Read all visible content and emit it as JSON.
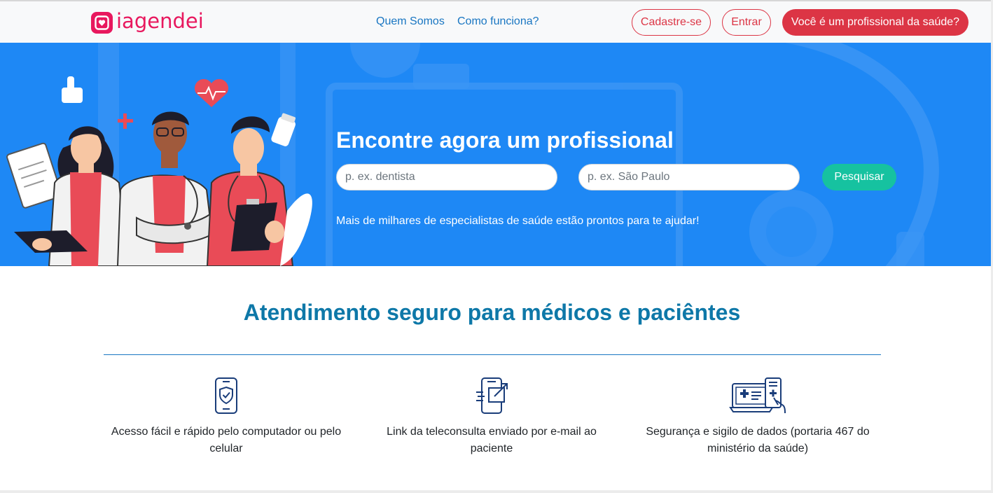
{
  "header": {
    "logo_text": "iagendei",
    "nav": [
      {
        "label": "Quem Somos"
      },
      {
        "label": "Como funciona?"
      }
    ],
    "signup_label": "Cadastre-se",
    "login_label": "Entrar",
    "pro_label": "Você é um profissional da saúde?"
  },
  "hero": {
    "title": "Encontre agora um profissional",
    "specialty_placeholder": "p. ex. dentista",
    "location_placeholder": "p. ex. São Paulo",
    "search_label": "Pesquisar",
    "subtitle": "Mais de milhares de especialistas de saúde estão prontos para te ajudar!"
  },
  "features": {
    "title": "Atendimento seguro para médicos e paciêntes",
    "items": [
      {
        "icon": "shield-phone-icon",
        "text": "Acesso fácil e rápido pelo computador ou pelo celular"
      },
      {
        "icon": "phone-link-icon",
        "text": "Link da teleconsulta enviado por e-mail ao paciente"
      },
      {
        "icon": "medical-devices-icon",
        "text": "Segurança e sigilo de dados (portaria 467 do ministério da saúde)"
      }
    ]
  },
  "colors": {
    "brand": "#e8185e",
    "link": "#1976c2",
    "danger": "#dc3545",
    "hero_bg": "#1e88f5",
    "search_button": "#16c2a0",
    "section_title": "#0e78a8"
  }
}
